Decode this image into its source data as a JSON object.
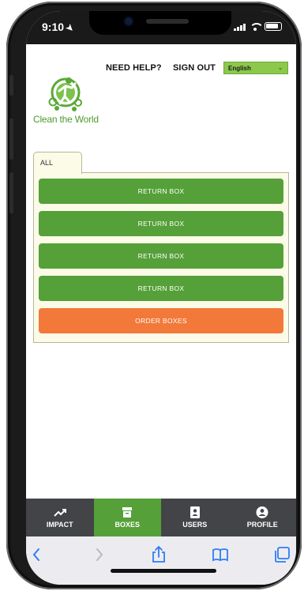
{
  "status_bar": {
    "time": "9:10",
    "location_icon": "location-arrow-icon",
    "signal_icon": "cellular-signal-icon",
    "wifi_icon": "wifi-icon",
    "battery_icon": "battery-icon"
  },
  "header": {
    "need_help": "NEED HELP?",
    "sign_out": "SIGN OUT",
    "language": {
      "selected": "English",
      "caret_icon": "chevron-down-icon"
    }
  },
  "logo": {
    "text": "Clean the World",
    "mark_icon": "clean-the-world-logo-icon"
  },
  "tabs": [
    {
      "label": "ALL"
    }
  ],
  "actions": [
    {
      "label": "RETURN BOX"
    },
    {
      "label": "RETURN BOX"
    },
    {
      "label": "RETURN BOX"
    },
    {
      "label": "RETURN BOX"
    },
    {
      "label": "ORDER BOXES"
    }
  ],
  "bottom_nav": {
    "items": [
      {
        "label": "IMPACT",
        "icon": "trend-up-icon",
        "active": false
      },
      {
        "label": "BOXES",
        "icon": "box-icon",
        "active": true
      },
      {
        "label": "USERS",
        "icon": "contacts-icon",
        "active": false
      },
      {
        "label": "PROFILE",
        "icon": "user-circle-icon",
        "active": false
      }
    ]
  },
  "safari_toolbar": {
    "back_icon": "chevron-left-icon",
    "forward_icon": "chevron-right-icon",
    "share_icon": "share-icon",
    "bookmarks_icon": "book-icon",
    "tabs_icon": "tabs-icon"
  },
  "colors": {
    "brand_green": "#55a039",
    "language_green": "#8cc84b",
    "order_orange": "#f2793a",
    "panel_bg": "#fbfbe8",
    "nav_bg": "#434447",
    "status_bar_bg": "#1a1a1a"
  }
}
